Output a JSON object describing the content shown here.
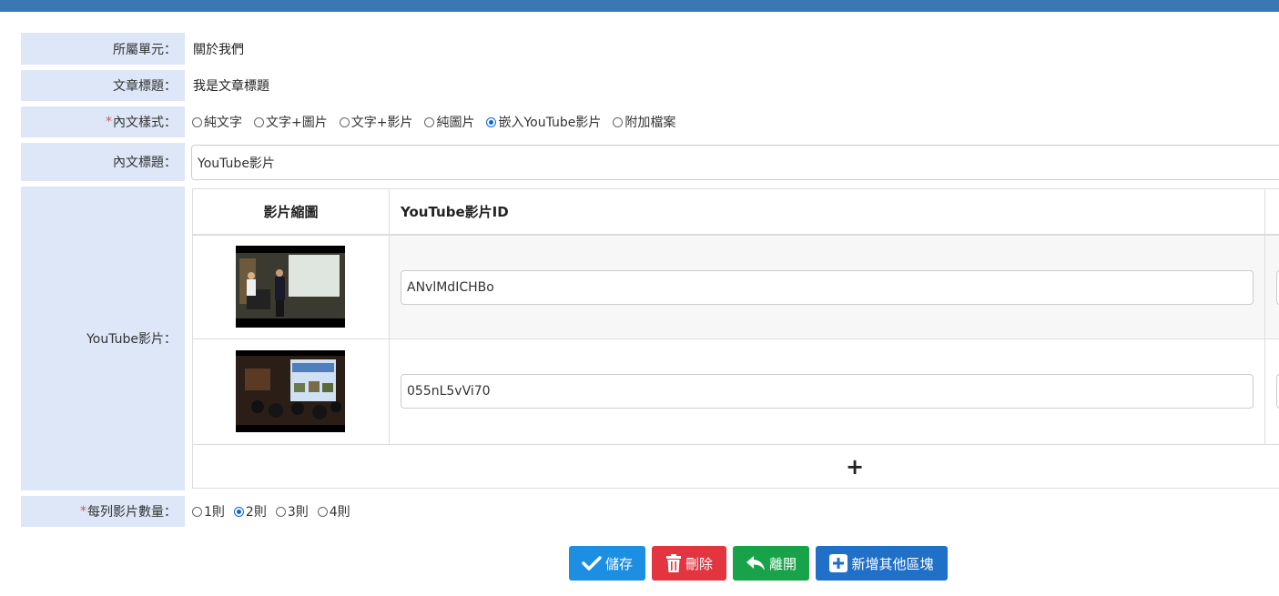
{
  "form": {
    "unit": {
      "label": "所屬單元：",
      "value": "關於我們"
    },
    "article_title": {
      "label": "文章標題：",
      "value": "我是文章標題"
    },
    "content_style": {
      "required_mark": "*",
      "label": "內文樣式：",
      "options": [
        "純文字",
        "文字+圖片",
        "文字+影片",
        "純圖片",
        "嵌入YouTube影片",
        "附加檔案"
      ],
      "selected": "嵌入YouTube影片"
    },
    "content_title": {
      "label": "內文標題：",
      "value": "YouTube影片"
    },
    "youtube": {
      "label": "YouTube影片：",
      "headers": {
        "thumb": "影片縮圖",
        "id": "YouTube影片ID"
      },
      "rows": [
        {
          "video_id": "ANvlMdICHBo"
        },
        {
          "video_id": "055nL5vVi70"
        }
      ],
      "add_symbol": "+"
    },
    "per_row": {
      "required_mark": "*",
      "label": "每列影片數量：",
      "options": [
        "1則",
        "2則",
        "3則",
        "4則"
      ],
      "selected": "2則"
    }
  },
  "actions": {
    "save": "儲存",
    "delete": "刪除",
    "leave": "離開",
    "add_block": "新增其他區塊"
  },
  "colors": {
    "topbar": "#3a78b5",
    "label_bg": "#dde7f7",
    "save": "#1d8fe3",
    "delete": "#e2353f",
    "leave": "#18a34a",
    "add_block": "#2070c8"
  }
}
